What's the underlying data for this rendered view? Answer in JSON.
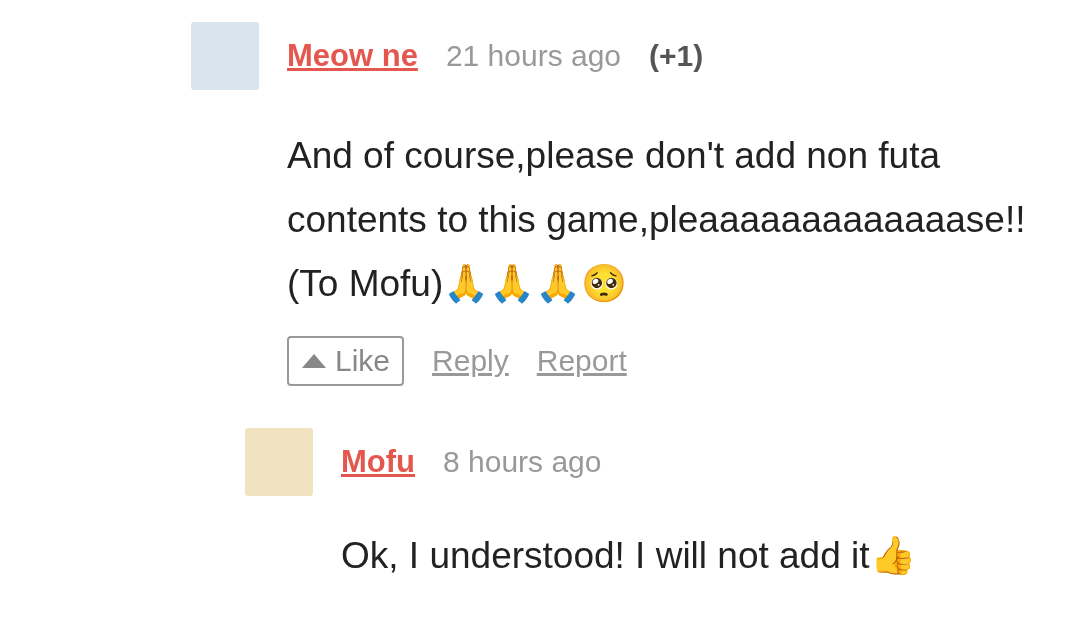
{
  "comments": [
    {
      "author": "Meow ne",
      "time": "21 hours ago",
      "score": "(+1)",
      "text": "And of course,please don't add non futa contents to this game,pleaaaaaaaaaaaaase!!(To Mofu)🙏🙏🙏🥺",
      "actions": {
        "like": "Like",
        "reply": "Reply",
        "report": "Report"
      },
      "replies": [
        {
          "author": "Mofu",
          "time": "8 hours ago",
          "text": "Ok, I understood! I will not add it👍"
        }
      ]
    }
  ]
}
